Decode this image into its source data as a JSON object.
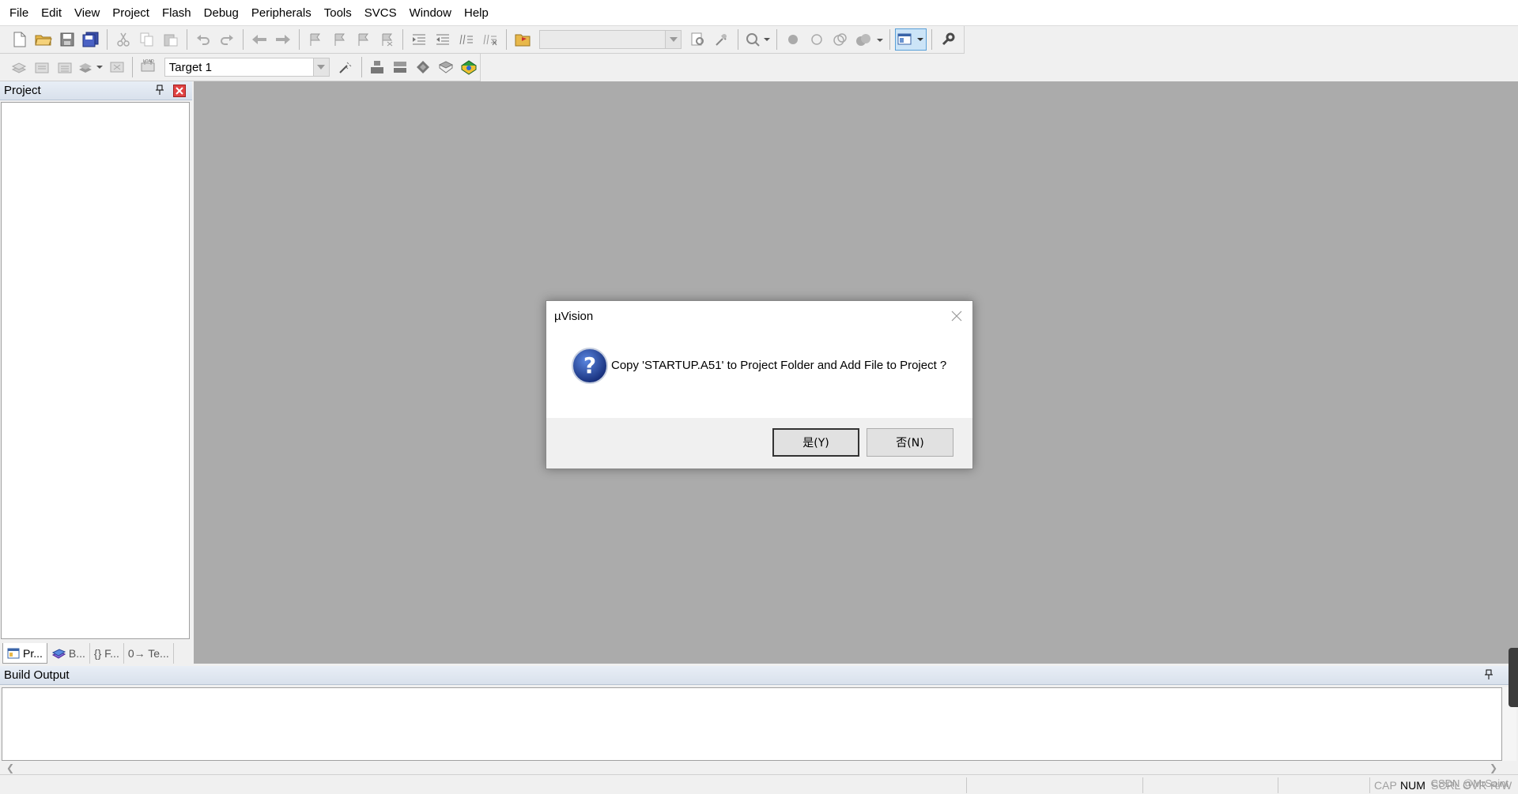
{
  "menu": [
    "File",
    "Edit",
    "View",
    "Project",
    "Flash",
    "Debug",
    "Peripherals",
    "Tools",
    "SVCS",
    "Window",
    "Help"
  ],
  "toolbar2": {
    "target": "Target 1"
  },
  "project_pane": {
    "title": "Project",
    "tabs": [
      "Pr...",
      "B...",
      "{} F...",
      "0→ Te..."
    ]
  },
  "build_output": {
    "title": "Build Output"
  },
  "status": {
    "indicators": [
      "CAP",
      "NUM",
      "SCRL",
      "OVR",
      "R/W"
    ],
    "watermark": "CSDN @MrSaint"
  },
  "dialog": {
    "title": "µVision",
    "message": "Copy 'STARTUP.A51' to Project Folder and Add File to Project ?",
    "yes_label": "是(Y)",
    "no_label": "否(N)"
  },
  "colors": {
    "client_bg": "#ababab",
    "pane_header": "#dbe3ee",
    "close_red": "#e04343"
  }
}
